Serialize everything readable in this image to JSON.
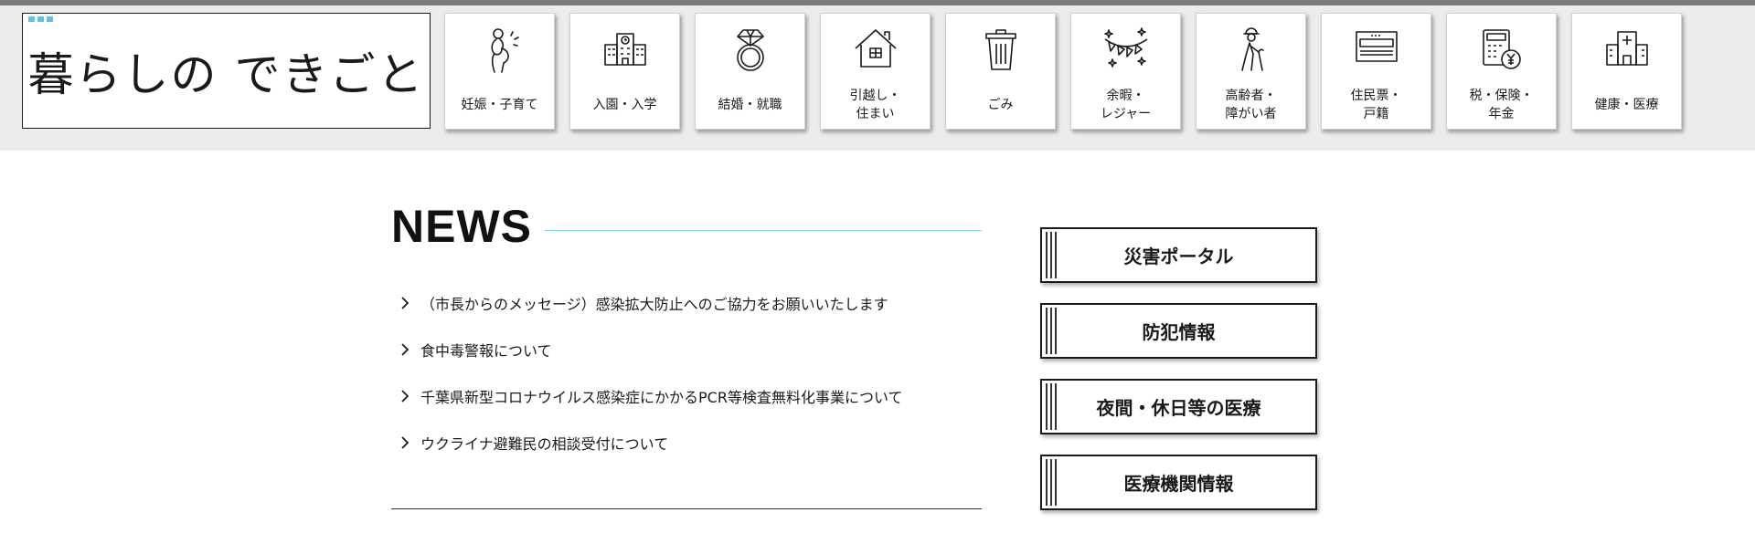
{
  "header": {
    "site_title": "暮らしの できごと",
    "categories": [
      {
        "label": "妊娠・子育て",
        "icon": "pregnancy-icon"
      },
      {
        "label": "入園・入学",
        "icon": "school-icon"
      },
      {
        "label": "結婚・就職",
        "icon": "ring-icon"
      },
      {
        "label": "引越し・\n住まい",
        "icon": "house-icon"
      },
      {
        "label": "ごみ",
        "icon": "trash-can-icon"
      },
      {
        "label": "余暇・\nレジャー",
        "icon": "party-garland-icon"
      },
      {
        "label": "高齢者・\n障がい者",
        "icon": "elderly-cane-icon"
      },
      {
        "label": "住民票・\n戸籍",
        "icon": "document-tray-icon"
      },
      {
        "label": "税・保険・\n年金",
        "icon": "calculator-yen-icon"
      },
      {
        "label": "健康・医療",
        "icon": "hospital-icon"
      }
    ]
  },
  "news": {
    "title": "NEWS",
    "items": [
      "（市長からのメッセージ）感染拡大防止へのご協力をお願いいたします",
      "食中毒警報について",
      "千葉県新型コロナウイルス感染症にかかるPCR等検査無料化事業について",
      "ウクライナ避難民の相談受付について"
    ]
  },
  "side_links": [
    "災害ポータル",
    "防犯情報",
    "夜間・休日等の医療",
    "医療機関情報"
  ],
  "colors": {
    "accent": "#5bc4e6",
    "header_bg": "#ececec",
    "news_rule": "#7fd0ea"
  }
}
